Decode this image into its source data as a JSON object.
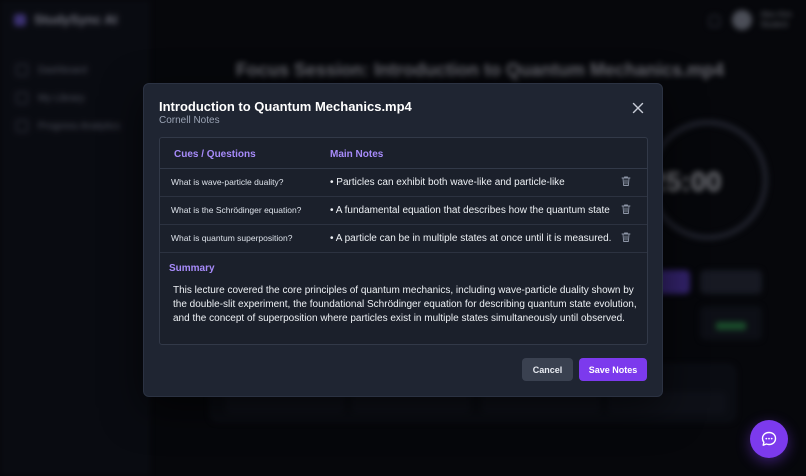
{
  "background": {
    "brand": "StudySync AI",
    "nav": [
      "Dashboard",
      "My Library",
      "Progress Analytics"
    ],
    "user": {
      "name": "Alex Kim",
      "role": "Student"
    },
    "page_title": "Focus Session: Introduction to Quantum Mechanics.mp4",
    "timer": "25:00"
  },
  "modal": {
    "title": "Introduction to Quantum Mechanics.mp4",
    "subtitle": "Cornell Notes",
    "columns": {
      "cues": "Cues / Questions",
      "notes": "Main Notes"
    },
    "rows": [
      {
        "cue": "What is wave-particle duality?",
        "note": "• Particles can exhibit both wave-like and particle-like"
      },
      {
        "cue": "What is the Schrödinger equation?",
        "note": "• A fundamental equation that describes how the quantum state"
      },
      {
        "cue": "What is quantum superposition?",
        "note": "• A particle can be in multiple states at once until it is measured."
      }
    ],
    "summary_label": "Summary",
    "summary": "This lecture covered the core principles of quantum mechanics, including wave-particle duality shown by the double-slit experiment, the foundational Schrödinger equation for describing quantum state evolution, and the concept of superposition where particles exist in multiple states simultaneously until observed.",
    "cancel_label": "Cancel",
    "save_label": "Save Notes"
  },
  "icons": {
    "close": "close-icon",
    "delete": "trash-icon",
    "chat": "chat-icon"
  },
  "colors": {
    "accent": "#7c3aed",
    "accent_text": "#a78bfa",
    "modal_bg": "#1f2532"
  }
}
